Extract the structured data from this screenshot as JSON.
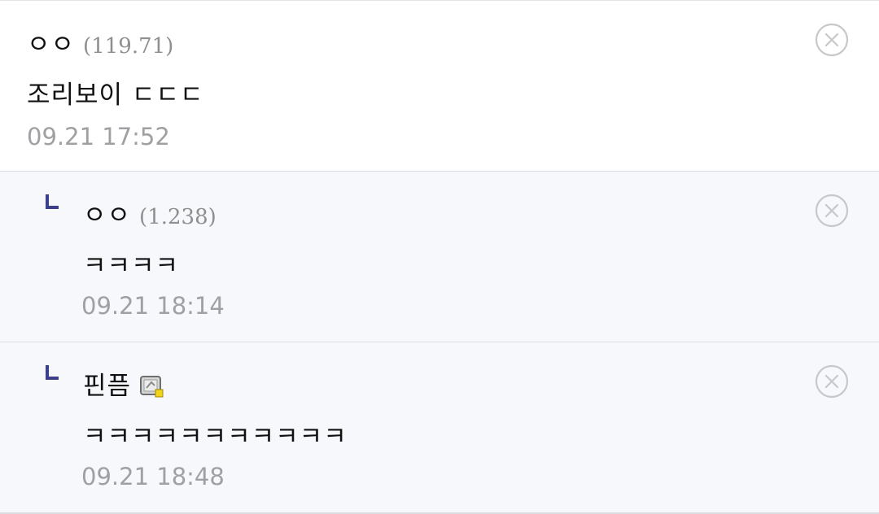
{
  "comments": [
    {
      "author": "ㅇㅇ",
      "ip": "(119.71)",
      "body": "조리보이 ㄷㄷㄷ",
      "time": "09.21 17:52"
    }
  ],
  "replies": [
    {
      "author": "ㅇㅇ",
      "ip": "(1.238)",
      "body": "ㅋㅋㅋㅋ",
      "time": "09.21 18:14"
    },
    {
      "author": "핀픔",
      "body": "ㅋㅋㅋㅋㅋㅋㅋㅋㅋㅋㅋ",
      "time": "09.21 18:48",
      "badge_icon": "gallery-nickname-icon"
    }
  ],
  "colors": {
    "reply_arrow": "#3b3f8c",
    "reply_bg": "#f7f8fb",
    "meta_text": "#a0a0a4",
    "delete_icon": "#c8c8cc"
  },
  "icons": {
    "delete": "circle-x-icon",
    "reply": "reply-arrow-icon"
  }
}
